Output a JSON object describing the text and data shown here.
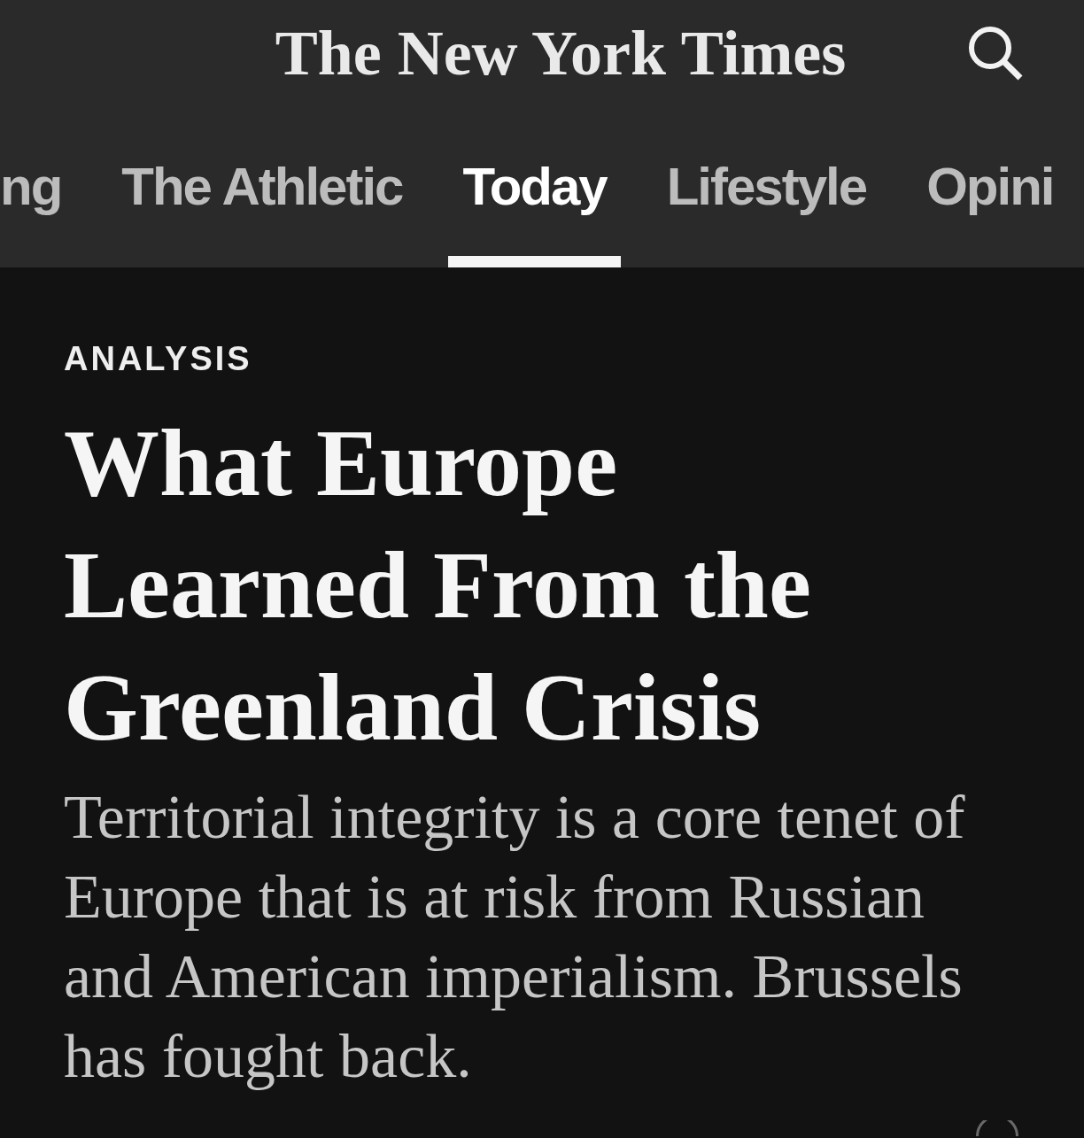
{
  "header": {
    "logo": "The New York Times"
  },
  "tabs": [
    {
      "label": "ng",
      "selected": false
    },
    {
      "label": "The Athletic",
      "selected": false
    },
    {
      "label": "Today",
      "selected": true
    },
    {
      "label": "Lifestyle",
      "selected": false
    },
    {
      "label": "Opini",
      "selected": false
    }
  ],
  "article": {
    "kicker": "ANALYSIS",
    "headline": "What Europe Learned From the Greenland Crisis",
    "summary": "Territorial integrity is a core tenet of Europe that is at risk from Russian and American imperialism. Brussels has fought back."
  }
}
